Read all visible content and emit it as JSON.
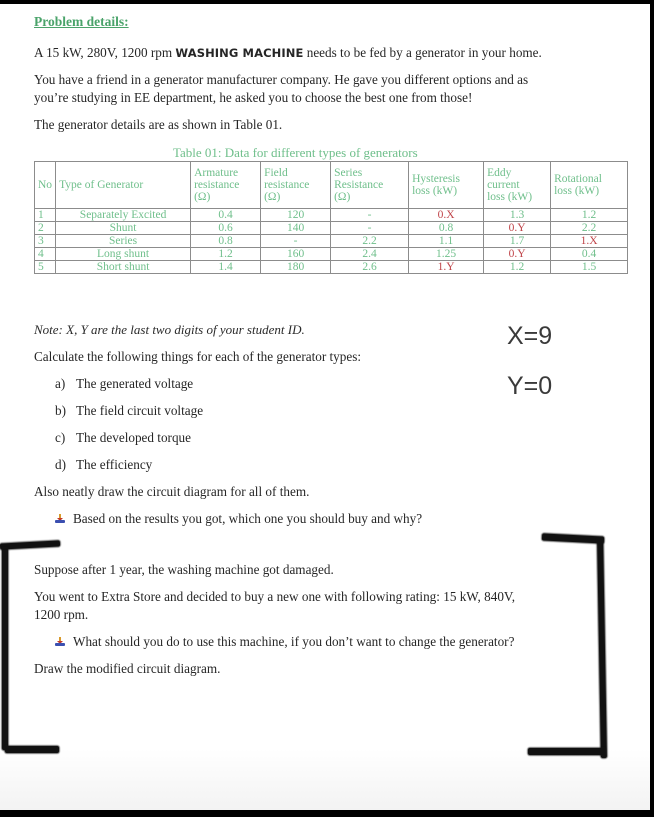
{
  "document": {
    "heading": "Problem details:",
    "intro": {
      "prefix": "A 15 kW, 280V, 1200 rpm ",
      "emphasis": "WASHING MACHINE",
      "suffix": " needs to be fed by a generator in your home."
    },
    "friend_line1": "You have a friend in a generator manufacturer company. He gave you different options and as",
    "friend_line2": "you’re studying in EE department, he asked you to choose the best one from those!",
    "table_ref": "The generator details are as shown in Table 01."
  },
  "table": {
    "caption": "Table 01: Data for different types of generators",
    "headers": {
      "no": "No",
      "type": "Type of Generator",
      "armature": [
        "Armature",
        "resistance",
        "(Ω)"
      ],
      "field": [
        "Field",
        "resistance",
        "(Ω)"
      ],
      "series": [
        "Series",
        "Resistance",
        "(Ω)"
      ],
      "hysteresis": [
        "Hysteresis",
        "loss (kW)"
      ],
      "eddy": [
        "Eddy",
        "current",
        "loss (kW)"
      ],
      "rotational": [
        "Rotational",
        "loss (kW)"
      ]
    },
    "rows": [
      {
        "no": "1",
        "type": "Separately Excited",
        "armature": "0.4",
        "field": "120",
        "series": "-",
        "hysteresis": "0.X",
        "eddy": "1.3",
        "rotational": "1.2"
      },
      {
        "no": "2",
        "type": "Shunt",
        "armature": "0.6",
        "field": "140",
        "series": "-",
        "hysteresis": "0.8",
        "eddy": "0.Y",
        "rotational": "2.2"
      },
      {
        "no": "3",
        "type": "Series",
        "armature": "0.8",
        "field": "-",
        "series": "2.2",
        "hysteresis": "1.1",
        "eddy": "1.7",
        "rotational": "1.X"
      },
      {
        "no": "4",
        "type": "Long shunt",
        "armature": "1.2",
        "field": "160",
        "series": "2.4",
        "hysteresis": "1.25",
        "eddy": "0.Y",
        "rotational": "0.4"
      },
      {
        "no": "5",
        "type": "Short shunt",
        "armature": "1.4",
        "field": "180",
        "series": "2.6",
        "hysteresis": "1.Y",
        "eddy": "1.2",
        "rotational": "1.5"
      }
    ],
    "highlight_color": "#c0454a",
    "text_color": "#6fbf8b"
  },
  "questions": {
    "note": "Note: X, Y are the last two digits of your student ID.",
    "calculate": "Calculate the following things for each of the generator types:",
    "items": [
      {
        "marker": "a)",
        "text": "The generated voltage"
      },
      {
        "marker": "b)",
        "text": "The field circuit voltage"
      },
      {
        "marker": "c)",
        "text": "The developed torque"
      },
      {
        "marker": "d)",
        "text": "The efficiency"
      }
    ],
    "draw": "Also neatly draw the circuit diagram for all of them.",
    "buy_question": "Based on the results you got, which one you should buy and why?"
  },
  "annotations": {
    "x_value": "X=9",
    "y_value": "Y=0"
  },
  "part2": {
    "suppose": "Suppose after 1 year, the washing machine got damaged.",
    "store_line1": "You went to Extra Store and decided to buy a new one with following rating: 15 kW, 840V,",
    "store_line2": "1200 rpm.",
    "question": "What should you do to use this machine, if you don’t want to change the generator?",
    "draw": "Draw the modified circuit diagram."
  },
  "icons": {
    "bullet": "arrow-down-bullet-icon"
  }
}
